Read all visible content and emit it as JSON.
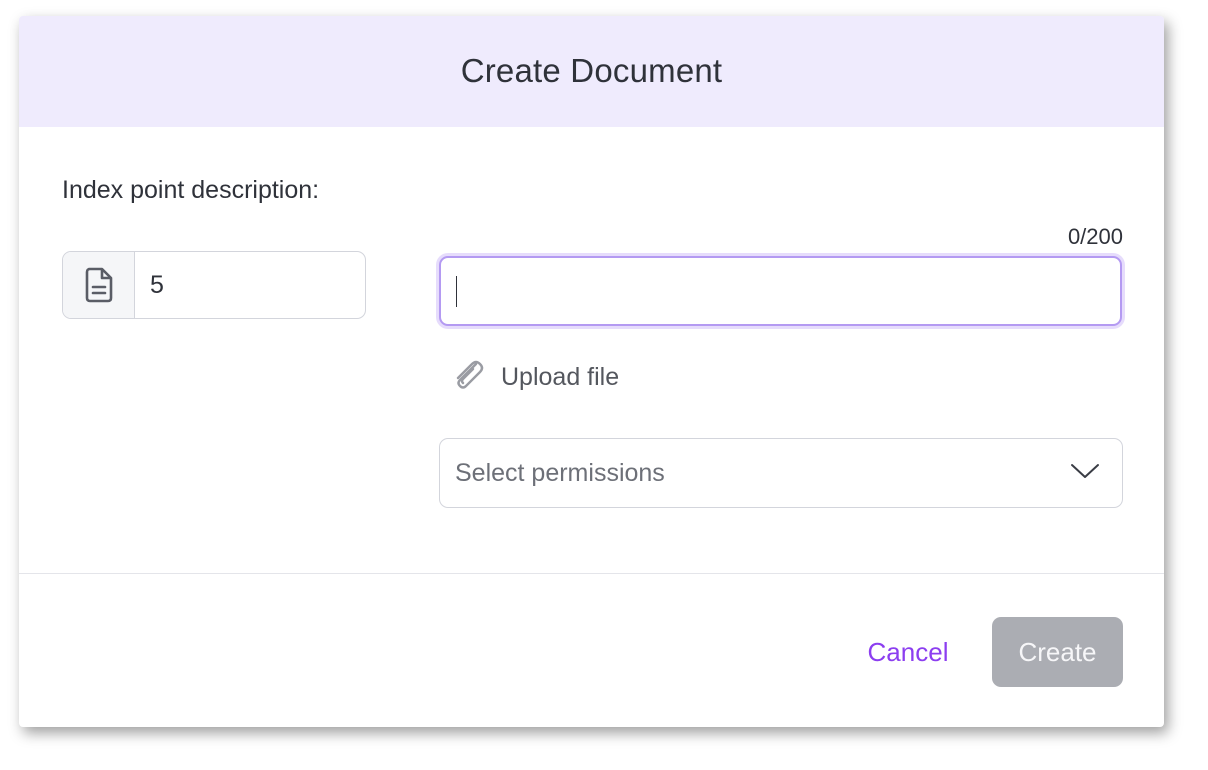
{
  "dialog": {
    "title": "Create Document"
  },
  "form": {
    "index_label": "Index point description:",
    "index_value": "5",
    "index_icon": "document-icon",
    "char_counter": "0/200",
    "description_value": "",
    "upload_label": "Upload file",
    "upload_icon": "paperclip-icon",
    "permissions_placeholder": "Select permissions",
    "permissions_icon": "chevron-down-icon"
  },
  "footer": {
    "cancel_label": "Cancel",
    "create_label": "Create"
  },
  "colors": {
    "header_bg": "#efebfd",
    "accent": "#8c3ef0",
    "focus_border": "#b49af2",
    "disabled_button": "#abadb3"
  }
}
